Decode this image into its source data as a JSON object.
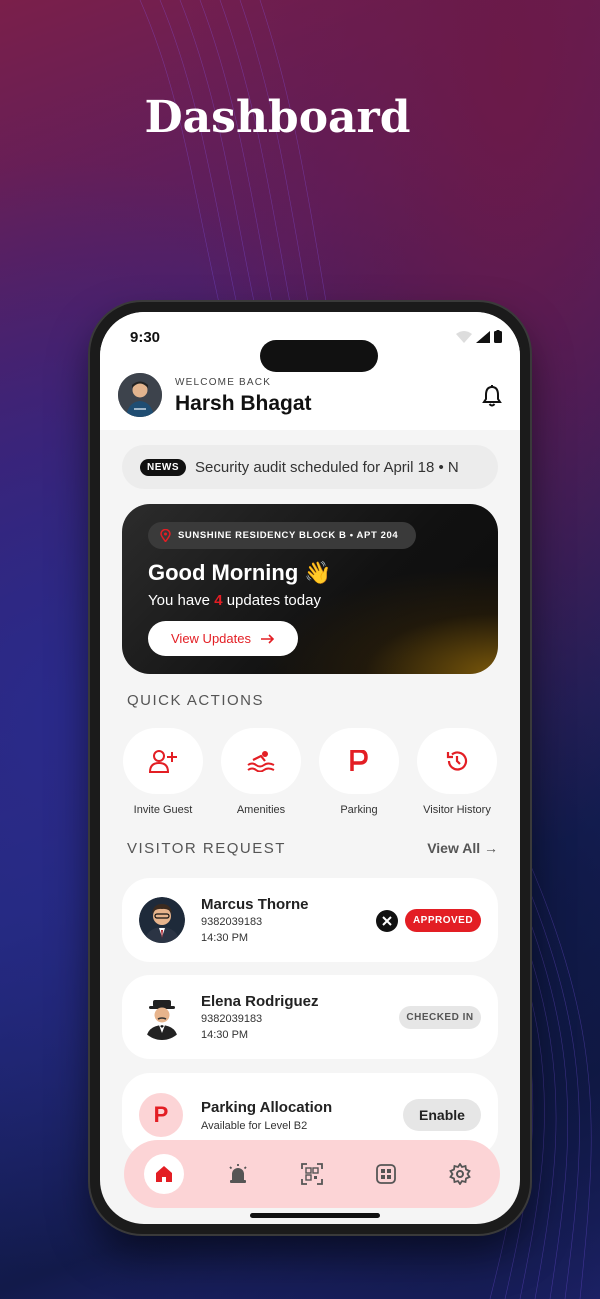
{
  "page": {
    "heading": "Dashboard"
  },
  "status_bar": {
    "time": "9:30"
  },
  "header": {
    "welcome": "WELCOME BACK",
    "name": "Harsh Bhagat"
  },
  "news": {
    "tag": "NEWS",
    "text": "Security audit scheduled for April 18 • N"
  },
  "hero": {
    "location": "SUNSHINE RESIDENCY BLOCK B • APT 204",
    "greeting": "Good Morning 👋",
    "sub_prefix": "You have",
    "update_count": "4",
    "sub_suffix": "updates today",
    "button": "View Updates"
  },
  "quick_actions": {
    "title": "QUICK ACTIONS",
    "items": [
      {
        "label": "Invite Guest",
        "icon": "add-user-icon"
      },
      {
        "label": "Amenities",
        "icon": "pool-icon"
      },
      {
        "label": "Parking",
        "icon": "parking-icon"
      },
      {
        "label": "Visitor History",
        "icon": "history-icon"
      }
    ]
  },
  "visitor_request": {
    "title": "VISITOR REQUEST",
    "view_all": "View All →",
    "items": [
      {
        "name": "Marcus Thorne",
        "phone": "9382039183",
        "time": "14:30 PM",
        "status": "APPROVED"
      },
      {
        "name": "Elena Rodriguez",
        "phone": "9382039183",
        "time": "14:30 PM",
        "status": "CHECKED IN"
      },
      {
        "name": "Parking Allocation",
        "subtitle": "Available for Level B2",
        "letter": "P",
        "action": "Enable"
      }
    ]
  },
  "nav": {
    "items": [
      "home-icon",
      "alarm-icon",
      "qr-code-icon",
      "grid-icon",
      "settings-icon"
    ]
  },
  "colors": {
    "accent": "#e31e24",
    "nav_bg": "#fcd4d6"
  }
}
